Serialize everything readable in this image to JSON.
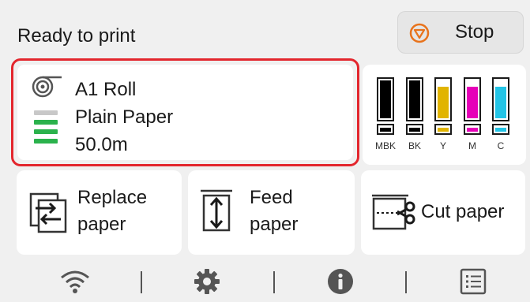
{
  "header": {
    "status_text": "Ready to print",
    "stop_label": "Stop",
    "stop_icon": "stop-icon",
    "stop_color": "#e8731c"
  },
  "paper": {
    "size": "A1 Roll",
    "type": "Plain Paper",
    "remaining": "50.0m",
    "icon": "roll-paper-icon",
    "remaining_level_bars": 3,
    "remaining_level_max": 4,
    "level_color": "#2bb24c",
    "highlight_color": "#e3262d"
  },
  "inks": [
    {
      "name": "MBK",
      "color": "#000000",
      "level": 1.0
    },
    {
      "name": "BK",
      "color": "#000000",
      "level": 1.0
    },
    {
      "name": "Y",
      "color": "#e1b400",
      "level": 0.82
    },
    {
      "name": "M",
      "color": "#e600b8",
      "level": 0.82
    },
    {
      "name": "C",
      "color": "#22c4e6",
      "level": 0.82
    }
  ],
  "actions": {
    "replace_paper": {
      "line1": "Replace",
      "line2": "paper",
      "icon": "replace-paper-icon"
    },
    "feed_paper": {
      "line1": "Feed",
      "line2": "paper",
      "icon": "feed-paper-icon"
    },
    "cut_paper": {
      "label": "Cut paper",
      "icon": "cut-paper-icon"
    }
  },
  "nav": [
    "wifi-icon",
    "settings-gear-icon",
    "info-icon",
    "job-list-icon"
  ]
}
